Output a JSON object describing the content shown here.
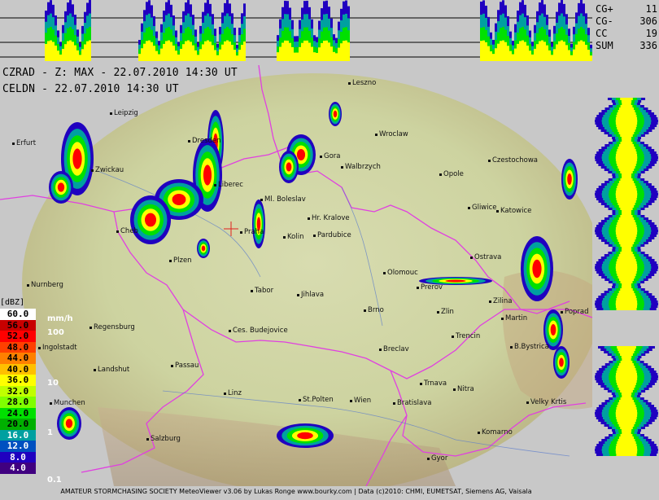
{
  "stats": [
    {
      "label": "CG+",
      "value": "11"
    },
    {
      "label": "CG-",
      "value": "306"
    },
    {
      "label": "CC",
      "value": "19"
    },
    {
      "label": "SUM",
      "value": "336"
    }
  ],
  "header": {
    "line1": "CZRAD - Z: MAX - 22.07.2010 14:30 UT",
    "line2": "CELDN - 22.07.2010 14:30 UT"
  },
  "legend": {
    "unit": "[dBZ]",
    "rate_unit": "mm/h",
    "steps": [
      {
        "value": "60.0",
        "color": "#ffffff"
      },
      {
        "value": "56.0",
        "color": "#c80000"
      },
      {
        "value": "52.0",
        "color": "#ff0000"
      },
      {
        "value": "48.0",
        "color": "#ff4000"
      },
      {
        "value": "44.0",
        "color": "#ff8000"
      },
      {
        "value": "40.0",
        "color": "#ffc000"
      },
      {
        "value": "36.0",
        "color": "#ffff00"
      },
      {
        "value": "32.0",
        "color": "#c0ff00"
      },
      {
        "value": "28.0",
        "color": "#80ff00"
      },
      {
        "value": "24.0",
        "color": "#00e000"
      },
      {
        "value": "20.0",
        "color": "#00b000"
      },
      {
        "value": "16.0",
        "color": "#00a0a0"
      },
      {
        "value": "12.0",
        "color": "#0050c0"
      },
      {
        "value": "8.0",
        "color": "#2000c0"
      },
      {
        "value": "4.0",
        "color": "#400080"
      }
    ],
    "rates": [
      "100",
      "10",
      "1",
      "0.1"
    ]
  },
  "cities": [
    "Leszno",
    "Leipzig",
    "Wroclaw",
    "Erfurt",
    "Dresden",
    "Gora",
    "Zwickau",
    "Walbrzych",
    "Opole",
    "Czestochowa",
    "Liberec",
    "Ml. Boleslav",
    "Gliwice",
    "Katowice",
    "Hr. Kralove",
    "Cheb",
    "Pardubice",
    "Praha",
    "Kolin",
    "Ostrava",
    "Plzen",
    "Olomouc",
    "Nurnberg",
    "Tabor",
    "Jihlava",
    "Prerov",
    "Zilina",
    "Brno",
    "Zlin",
    "Poprad",
    "Martin",
    "Regensburg",
    "Ces. Budejovice",
    "Trencin",
    "Ingolstadt",
    "B.Bystrica",
    "Breclav",
    "Passau",
    "Landshut",
    "Trnava",
    "Nitra",
    "Linz",
    "St.Polten",
    "Wien",
    "Bratislava",
    "Velky Krtis",
    "Munchen",
    "Salzburg",
    "Komarno",
    "Gyor"
  ],
  "footer": "AMATEUR STORMCHASING SOCIETY MeteoViewer v3.06 by Lukas Ronge www.bourky.com | Data (c)2010: CHMI, EUMETSAT, Siemens AG, Vaisala"
}
